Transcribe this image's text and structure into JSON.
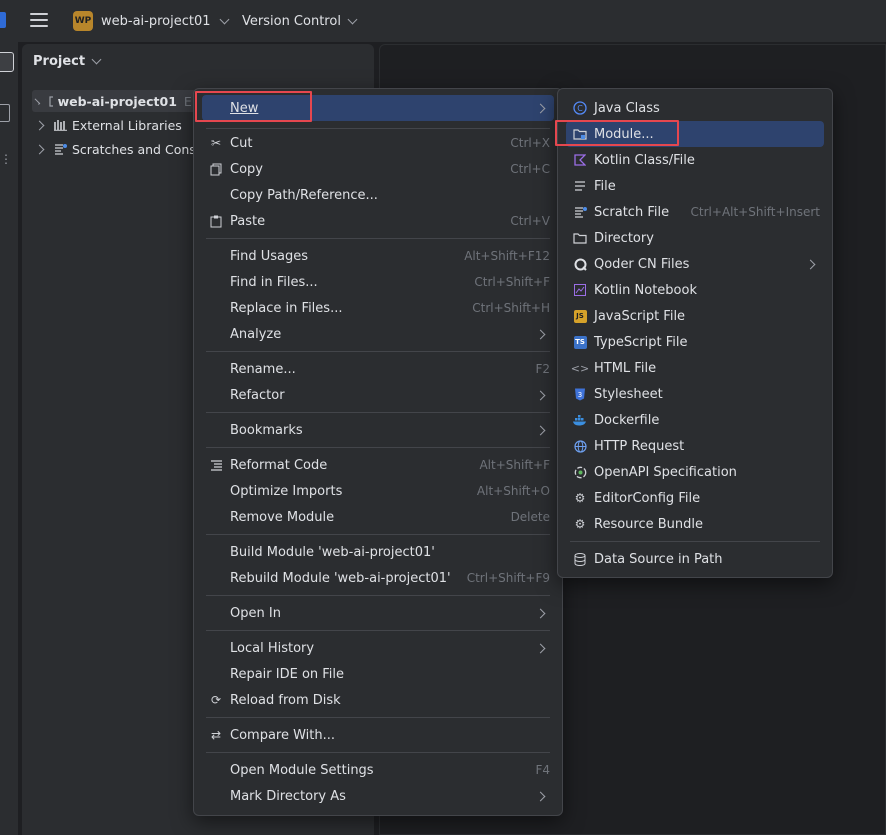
{
  "titlebar": {
    "project_badge": "WP",
    "project_name": "web-ai-project01",
    "vcs": "Version Control"
  },
  "project_panel": {
    "title": "Project",
    "tree": [
      {
        "label": "web-ai-project01",
        "suffix": "E:",
        "icon": "module-folder-icon"
      },
      {
        "label": "External Libraries",
        "icon": "library-icon"
      },
      {
        "label": "Scratches and Consc",
        "icon": "scratches-icon"
      }
    ]
  },
  "context_menu": {
    "items": [
      {
        "label": "New",
        "submenu": true
      },
      {
        "label": "Cut",
        "shortcut": "Ctrl+X",
        "icon": "scissors-icon"
      },
      {
        "label": "Copy",
        "shortcut": "Ctrl+C",
        "icon": "copy-icon"
      },
      {
        "label": "Copy Path/Reference..."
      },
      {
        "label": "Paste",
        "shortcut": "Ctrl+V",
        "icon": "paste-icon"
      },
      {
        "label": "Find Usages",
        "shortcut": "Alt+Shift+F12"
      },
      {
        "label": "Find in Files...",
        "shortcut": "Ctrl+Shift+F"
      },
      {
        "label": "Replace in Files...",
        "shortcut": "Ctrl+Shift+H"
      },
      {
        "label": "Analyze",
        "submenu": true
      },
      {
        "label": "Rename...",
        "shortcut": "F2"
      },
      {
        "label": "Refactor",
        "submenu": true
      },
      {
        "label": "Bookmarks",
        "submenu": true
      },
      {
        "label": "Reformat Code",
        "shortcut": "Alt+Shift+F",
        "icon": "reformat-icon"
      },
      {
        "label": "Optimize Imports",
        "shortcut": "Alt+Shift+O"
      },
      {
        "label": "Remove Module",
        "shortcut": "Delete"
      },
      {
        "label": "Build Module 'web-ai-project01'"
      },
      {
        "label": "Rebuild Module 'web-ai-project01'",
        "shortcut": "Ctrl+Shift+F9"
      },
      {
        "label": "Open In",
        "submenu": true
      },
      {
        "label": "Local History",
        "submenu": true
      },
      {
        "label": "Repair IDE on File"
      },
      {
        "label": "Reload from Disk",
        "icon": "reload-icon"
      },
      {
        "label": "Compare With...",
        "icon": "compare-icon"
      },
      {
        "label": "Open Module Settings",
        "shortcut": "F4"
      },
      {
        "label": "Mark Directory As",
        "submenu": true
      }
    ]
  },
  "new_submenu": {
    "items": [
      {
        "label": "Java Class",
        "icon": "java-class-icon"
      },
      {
        "label": "Module...",
        "icon": "module-icon"
      },
      {
        "label": "Kotlin Class/File",
        "icon": "kotlin-icon"
      },
      {
        "label": "File",
        "icon": "file-icon"
      },
      {
        "label": "Scratch File",
        "shortcut": "Ctrl+Alt+Shift+Insert",
        "icon": "scratch-file-icon"
      },
      {
        "label": "Directory",
        "icon": "folder-icon"
      },
      {
        "label": "Qoder CN Files",
        "submenu": true,
        "icon": "qoder-icon"
      },
      {
        "label": "Kotlin Notebook",
        "icon": "notebook-icon"
      },
      {
        "label": "JavaScript File",
        "icon": "javascript-icon",
        "badge": "JS"
      },
      {
        "label": "TypeScript File",
        "icon": "typescript-icon",
        "badge": "TS"
      },
      {
        "label": "HTML File",
        "icon": "html-icon"
      },
      {
        "label": "Stylesheet",
        "icon": "css-icon"
      },
      {
        "label": "Dockerfile",
        "icon": "docker-icon"
      },
      {
        "label": "HTTP Request",
        "icon": "globe-icon"
      },
      {
        "label": "OpenAPI Specification",
        "icon": "openapi-icon"
      },
      {
        "label": "EditorConfig File",
        "icon": "gear-icon"
      },
      {
        "label": "Resource Bundle",
        "icon": "resource-bundle-icon"
      },
      {
        "label": "Data Source in Path",
        "icon": "database-icon"
      }
    ]
  }
}
